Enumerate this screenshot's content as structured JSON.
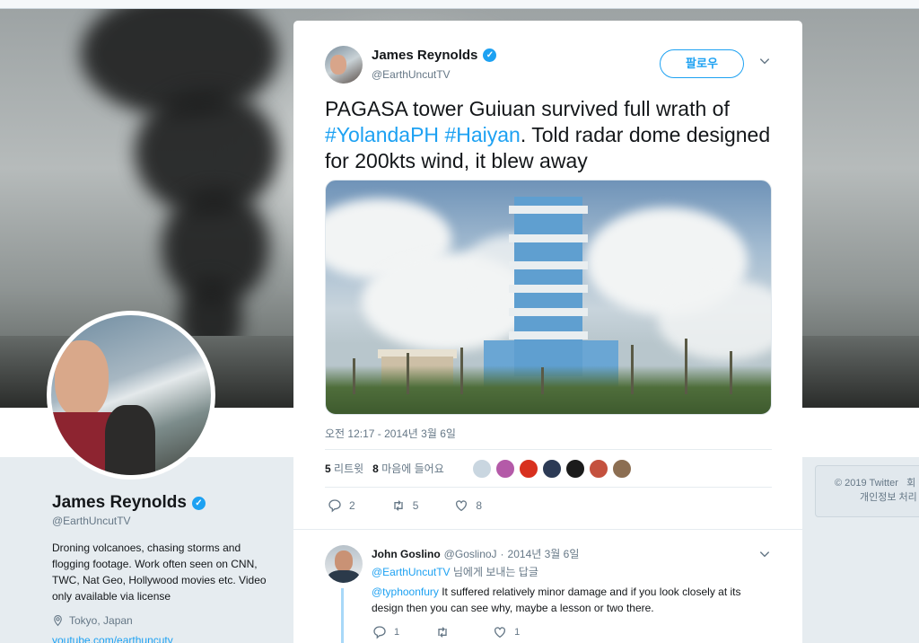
{
  "profile": {
    "name": "James Reynolds",
    "handle": "@EarthUncutTV",
    "bio": "Droning volcanoes, chasing storms and flogging footage. Work often seen on CNN, TWC, Nat Geo, Hollywood movies etc. Video only available via license",
    "location": "Tokyo, Japan",
    "link": "youtube.com/earthuncutv"
  },
  "footer": {
    "copyright": "© 2019 Twitter",
    "more": "회",
    "privacy": "개인정보 처리"
  },
  "tweet": {
    "author_name": "James Reynolds",
    "author_handle": "@EarthUncutTV",
    "follow_label": "팔로우",
    "text_part1": "PAGASA tower Guiuan survived full wrath of ",
    "hashtag1": "#YolandaPH",
    "hashtag2": "#Haiyan",
    "text_part2": ". Told radar dome designed for 200kts wind, it blew away",
    "timestamp": "오전 12:17 - 2014년 3월 6일",
    "retweets_count": "5",
    "retweets_label": "리트윗",
    "likes_count": "8",
    "likes_label": "마음에 들어요",
    "reply_count": "2",
    "retweet_count": "5",
    "like_count": "8"
  },
  "likers": [
    {
      "color": "#C9D6E0"
    },
    {
      "color": "#B45AA8"
    },
    {
      "color": "#D8301E"
    },
    {
      "color": "#2C3A55"
    },
    {
      "color": "#1B1B1B"
    },
    {
      "color": "#C4513E"
    },
    {
      "color": "#8C6E52"
    }
  ],
  "reply": {
    "name": "John Goslino",
    "handle": "@GoslinoJ",
    "date": "2014년 3월 6일",
    "replying_mention": "@EarthUncutTV",
    "replying_suffix": "님에게 보내는 답글",
    "mention": "@typhoonfury",
    "text": " It suffered relatively minor damage and if you look closely at its design then you can see why, maybe a lesson or two there.",
    "reply_count": "1",
    "retweet_count": "",
    "like_count": "1"
  },
  "colors": {
    "accent": "#1DA1F2",
    "text": "#14171A",
    "muted": "#657786"
  }
}
